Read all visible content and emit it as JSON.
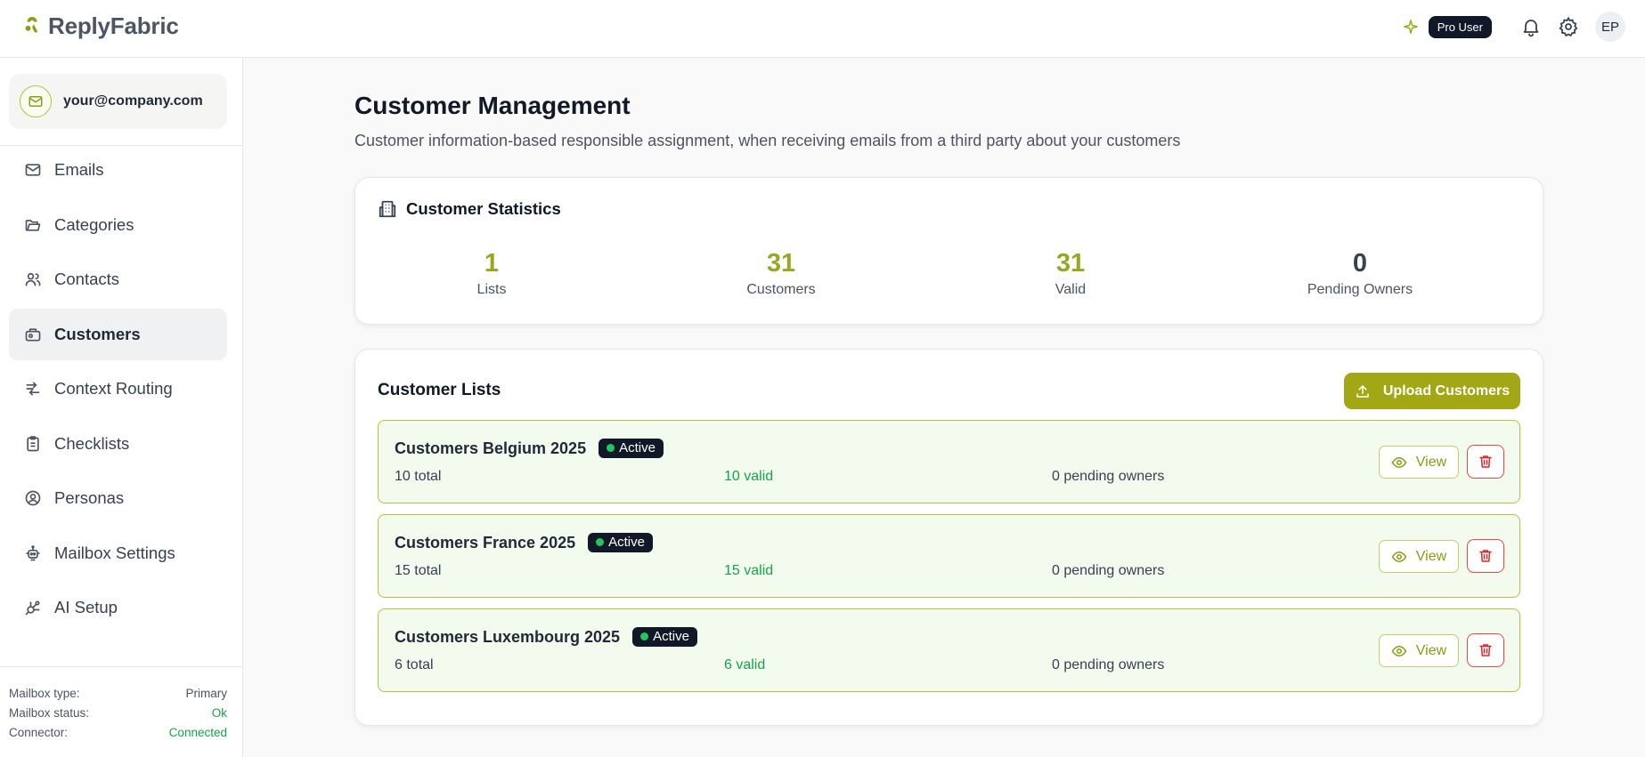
{
  "app": {
    "name": "ReplyFabric"
  },
  "topbar": {
    "plan_badge": "Pro User",
    "avatar_initials": "EP"
  },
  "account": {
    "email": "your@company.com"
  },
  "sidebar": {
    "items": [
      {
        "label": "Emails",
        "icon": "mail-icon"
      },
      {
        "label": "Categories",
        "icon": "folder-icon"
      },
      {
        "label": "Contacts",
        "icon": "users-icon"
      },
      {
        "label": "Customers",
        "icon": "briefcase-icon",
        "active": true
      },
      {
        "label": "Context Routing",
        "icon": "routing-icon"
      },
      {
        "label": "Checklists",
        "icon": "clipboard-icon"
      },
      {
        "label": "Personas",
        "icon": "persona-icon"
      },
      {
        "label": "Mailbox Settings",
        "icon": "robot-icon"
      },
      {
        "label": "AI Setup",
        "icon": "ai-icon"
      }
    ],
    "mailbox": {
      "type_label": "Mailbox type:",
      "type_value": "Primary",
      "status_label": "Mailbox status:",
      "status_value": "Ok",
      "connector_label": "Connector:",
      "connector_value": "Connected"
    }
  },
  "page": {
    "title": "Customer Management",
    "subtitle": "Customer information-based responsible assignment, when receiving emails from a third party about your customers"
  },
  "stats": {
    "title": "Customer Statistics",
    "items": [
      {
        "value": "1",
        "label": "Lists"
      },
      {
        "value": "31",
        "label": "Customers"
      },
      {
        "value": "31",
        "label": "Valid"
      },
      {
        "value": "0",
        "label": "Pending Owners"
      }
    ]
  },
  "lists": {
    "title": "Customer Lists",
    "upload_label": "Upload Customers",
    "view_label": "View",
    "rows": [
      {
        "name": "Customers Belgium 2025",
        "status": "Active",
        "total": "10 total",
        "valid": "10 valid",
        "pending": "0 pending owners"
      },
      {
        "name": "Customers France 2025",
        "status": "Active",
        "total": "15 total",
        "valid": "15 valid",
        "pending": "0 pending owners"
      },
      {
        "name": "Customers Luxembourg 2025",
        "status": "Active",
        "total": "6 total",
        "valid": "6 valid",
        "pending": "0 pending owners"
      }
    ]
  },
  "colors": {
    "accent": "#a2a814",
    "valid": "#16a34a",
    "danger": "#ef4444",
    "dark": "#111827"
  }
}
